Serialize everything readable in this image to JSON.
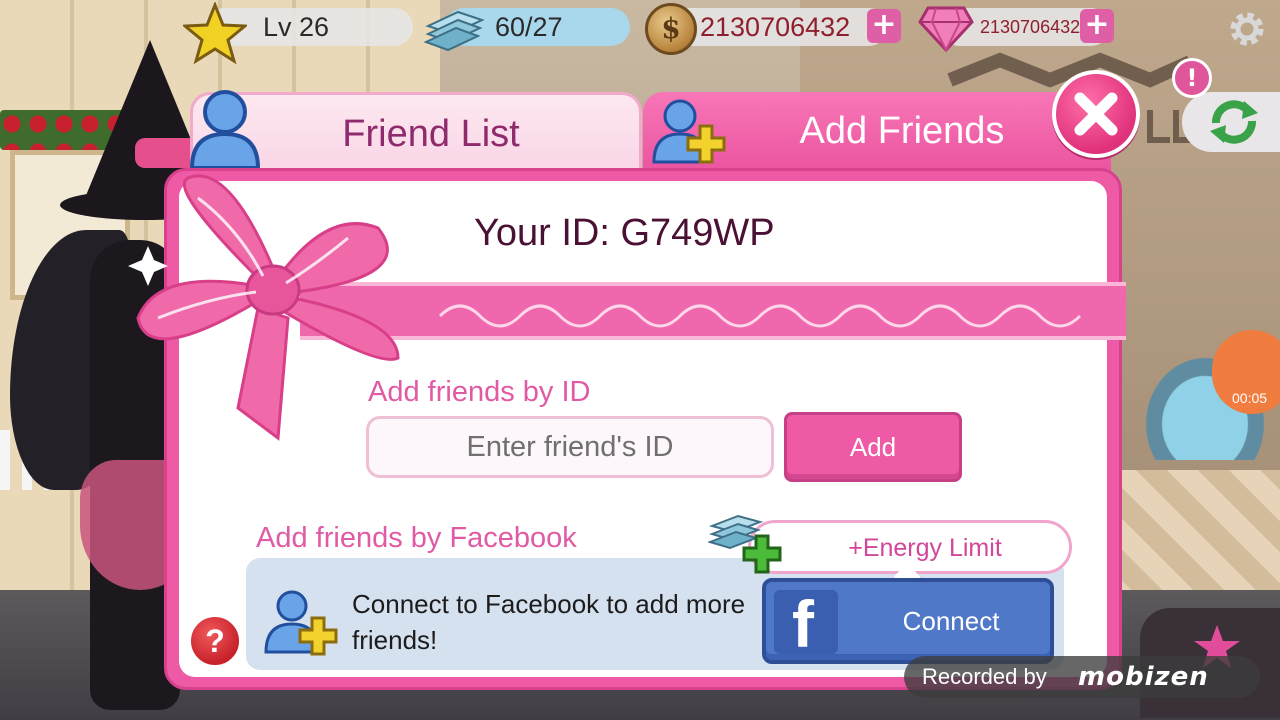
{
  "status_bar": {
    "level": "Lv 26",
    "energy": "60/27",
    "coins": "2130706432",
    "gems": "2130706432"
  },
  "tabs": [
    {
      "label": "Friend List",
      "active": false
    },
    {
      "label": "Add Friends",
      "active": true
    }
  ],
  "dialog": {
    "your_id": "Your ID: G749WP",
    "add_by_id_label": "Add friends by ID",
    "id_input_value": "",
    "id_input_placeholder": "Enter friend's ID",
    "add_button": "Add",
    "add_by_facebook_label": "Add friends by Facebook",
    "energy_bonus": "+Energy Limit",
    "facebook_text": "Connect to Facebook to add more friends!",
    "connect_button": "Connect",
    "help_glyph": "?"
  },
  "side": {
    "alert_glyph": "!",
    "recording_timer": "00:05"
  },
  "watermark": {
    "prefix": "Recorded by",
    "brand": "mobizen"
  },
  "icons": [
    "star-icon",
    "energy-icon",
    "coin-icon",
    "gem-icon",
    "plus-icon",
    "gear-icon",
    "user-icon",
    "add-user-icon",
    "close-icon",
    "refresh-icon",
    "facebook-icon",
    "help-icon",
    "ribbon-bow-icon"
  ],
  "colors": {
    "accent_pink": "#ee5aa6",
    "tab_text": "#8f2a6c",
    "label_pink": "#e05aa5",
    "facebook_blue": "#4f78c9"
  }
}
